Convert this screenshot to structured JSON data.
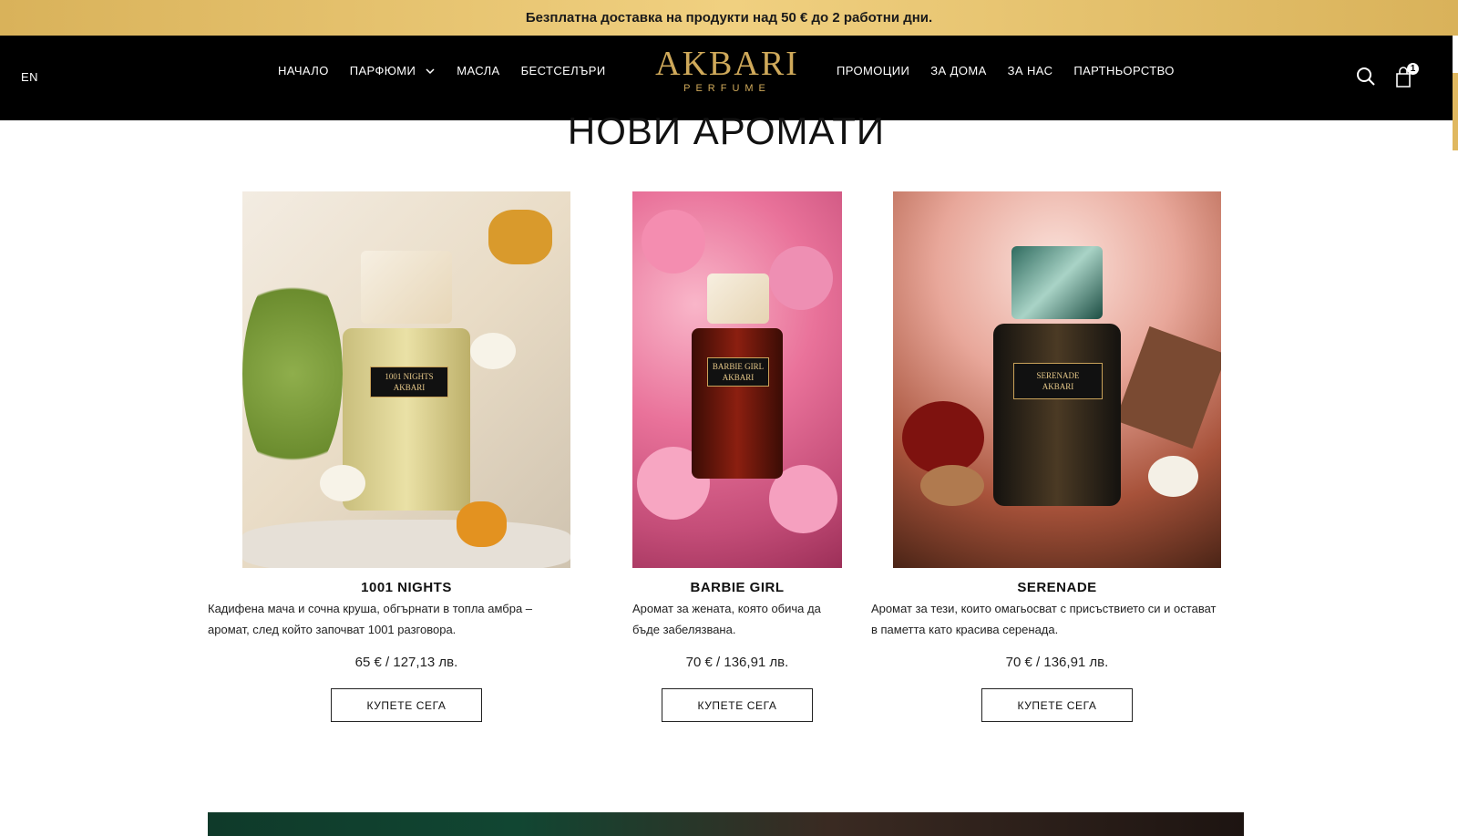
{
  "promo": {
    "text": "Безплатна доставка на продукти над 50 € до 2 работни дни."
  },
  "header": {
    "lang": "EN",
    "nav_left": [
      "НАЧАЛО",
      "ПАРФЮМИ",
      "МАСЛА",
      "БЕСТСЕЛЪРИ"
    ],
    "nav_right": [
      "ПРОМОЦИИ",
      "ЗА ДОМА",
      "ЗА НАС",
      "ПАРТНЬОРСТВО"
    ],
    "logo_main": "AKBARI",
    "logo_sub": "PERFUME",
    "cart_count": "1",
    "icons": {
      "search": "search-icon",
      "cart": "shopping-bag-icon",
      "dropdown": "chevron-down-icon"
    }
  },
  "section": {
    "title": "НОВИ АРОМАТИ"
  },
  "products": [
    {
      "name": "1001 NIGHTS",
      "description": "Кадифена мача и сочна круша, обгърнати в топла амбра – аромат, след който започват 1001 разговора.",
      "price": "65 € / 127,13 лв.",
      "button": "КУПЕТЕ СЕГА",
      "bottle_label": [
        "1001 NIGHTS",
        "AKBARI"
      ]
    },
    {
      "name": "BARBIE GIRL",
      "description": "Аромат за жената, която обича да бъде забелязвана.",
      "price": "70 € / 136,91 лв.",
      "button": "КУПЕТЕ СЕГА",
      "bottle_label": [
        "BARBIE GIRL",
        "AKBARI"
      ]
    },
    {
      "name": "SERENADE",
      "description": "Аромат за тези, които омагьосват с присъствието си и остават в паметта като красива серенада.",
      "price": "70 € / 136,91 лв.",
      "button": "КУПЕТЕ СЕГА",
      "bottle_label": [
        "SERENADE",
        "AKBARI"
      ]
    }
  ],
  "colors": {
    "gold": "#cfa95a",
    "header_bg": "#000000",
    "promo_bg": "#e6c06a"
  }
}
